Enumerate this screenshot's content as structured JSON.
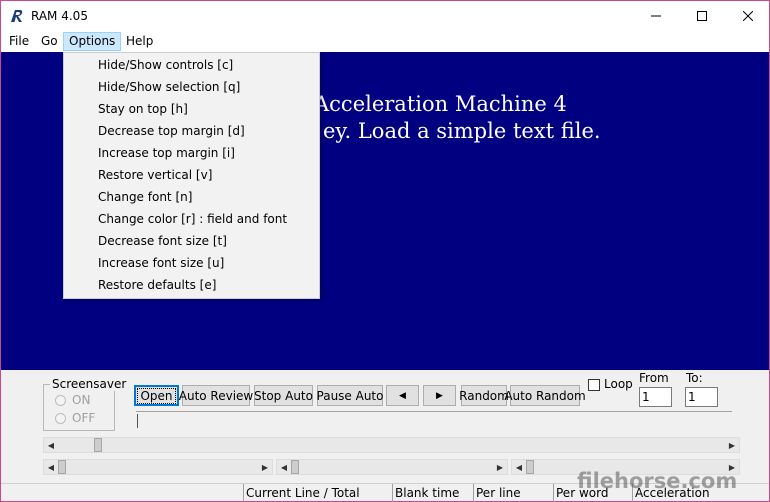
{
  "titlebar": {
    "title": "RAM 4.05",
    "icon": "app-r-icon"
  },
  "menubar": {
    "items": [
      "File",
      "Go",
      "Options",
      "Help"
    ],
    "active": "Options"
  },
  "stage": {
    "line1": "Acceleration Machine 4",
    "line2": "ey. Load a simple text file.",
    "background": "#000080",
    "text_color": "#ffffff"
  },
  "options_menu": {
    "items": [
      "Hide/Show controls [c]",
      "Hide/Show selection [q]",
      "Stay on top [h]",
      "Decrease top margin [d]",
      "Increase top margin [i]",
      "Restore vertical [v]",
      "Change font [n]",
      "Change color [r] : field and font",
      "Decrease font size [t]",
      "Increase font size [u]",
      "Restore defaults [e]"
    ]
  },
  "screensaver": {
    "title": "Screensaver",
    "on_label": "ON",
    "off_label": "OFF"
  },
  "buttons": {
    "open": "Open",
    "auto_review": "Auto Review",
    "stop_auto": "Stop Auto",
    "pause_auto": "Pause Auto",
    "prev": "◀",
    "next": "▶",
    "random": "Random",
    "auto_random": "Auto Random"
  },
  "loop": {
    "label": "Loop",
    "checked": false
  },
  "range": {
    "from_label": "From",
    "from_value": "1",
    "to_label": "To:",
    "to_value": "1"
  },
  "statusbar": {
    "cells": [
      "Current Line / Total",
      "Blank time",
      "Per line",
      "Per word",
      "Acceleration"
    ]
  },
  "watermark": "filehorse.com"
}
